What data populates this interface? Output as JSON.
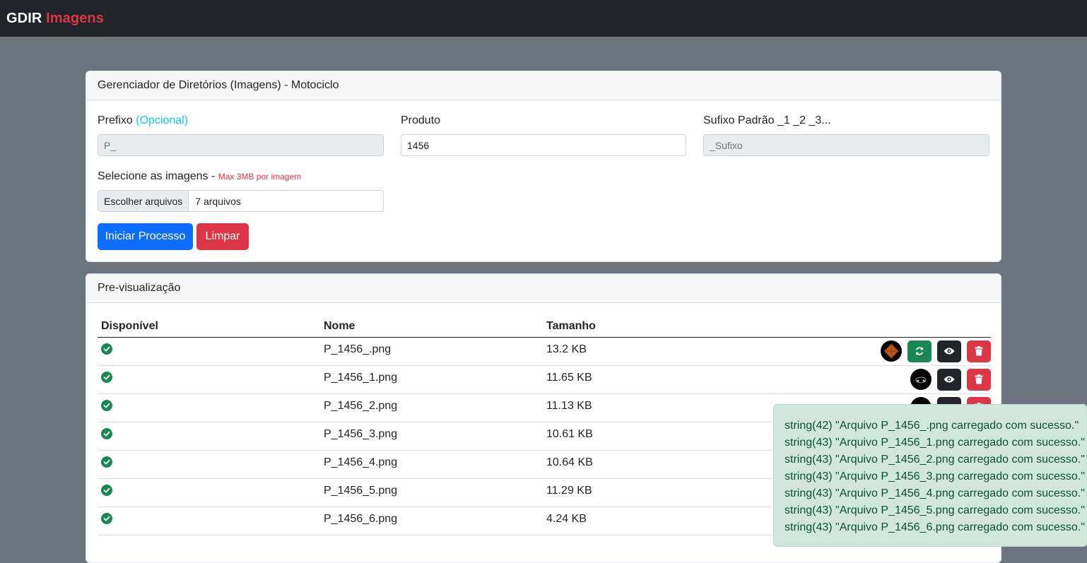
{
  "navbar": {
    "brand_main": "GDIR",
    "brand_accent": "Imagens"
  },
  "form_card": {
    "title": "Gerenciador de Diretórios (Imagens) - Motociclo",
    "prefix_label": "Prefixo",
    "prefix_optional": "(Opcional)",
    "prefix_placeholder": "P_",
    "product_label": "Produto",
    "product_value": "1456",
    "suffix_label": "Sufixo Padrão _1 _2 _3...",
    "suffix_placeholder": "_Sufixo",
    "images_label": "Selecione as imagens -",
    "images_hint": "Max 3MB por imagem",
    "file_button": "Escolher arquivos",
    "file_status": "7 arquivos",
    "start_button": "Iniciar Processo",
    "clear_button": "Limpar"
  },
  "preview_card": {
    "title": "Pre-visualização",
    "columns": [
      "Disponível",
      "Nome",
      "Tamanho"
    ],
    "rows": [
      {
        "name": "P_1456_.png",
        "size": "13.2 KB"
      },
      {
        "name": "P_1456_1.png",
        "size": "11.65 KB"
      },
      {
        "name": "P_1456_2.png",
        "size": "11.13 KB"
      },
      {
        "name": "P_1456_3.png",
        "size": "10.61 KB"
      },
      {
        "name": "P_1456_4.png",
        "size": "10.64 KB"
      },
      {
        "name": "P_1456_5.png",
        "size": "11.29 KB"
      },
      {
        "name": "P_1456_6.png",
        "size": "4.24 KB"
      }
    ]
  },
  "toast": {
    "lines": [
      "string(42) \"Arquivo P_1456_.png carregado com sucesso.\"",
      "string(43) \"Arquivo P_1456_1.png carregado com sucesso.\"",
      "string(43) \"Arquivo P_1456_2.png carregado com sucesso.\"",
      "string(43) \"Arquivo P_1456_3.png carregado com sucesso.\"",
      "string(43) \"Arquivo P_1456_4.png carregado com sucesso.\"",
      "string(43) \"Arquivo P_1456_5.png carregado com sucesso.\"",
      "string(43) \"Arquivo P_1456_6.png carregado com sucesso.\""
    ]
  },
  "icons": {
    "available": "check-circle-icon",
    "refresh": "refresh-icon",
    "view": "eye-icon",
    "delete": "trash-icon"
  },
  "colors": {
    "navbar": "#212529",
    "accent": "#dc3545",
    "primary": "#0d6efd",
    "success": "#198754",
    "toast_bg": "#d1e7dd",
    "toast_text": "#0f5132"
  }
}
